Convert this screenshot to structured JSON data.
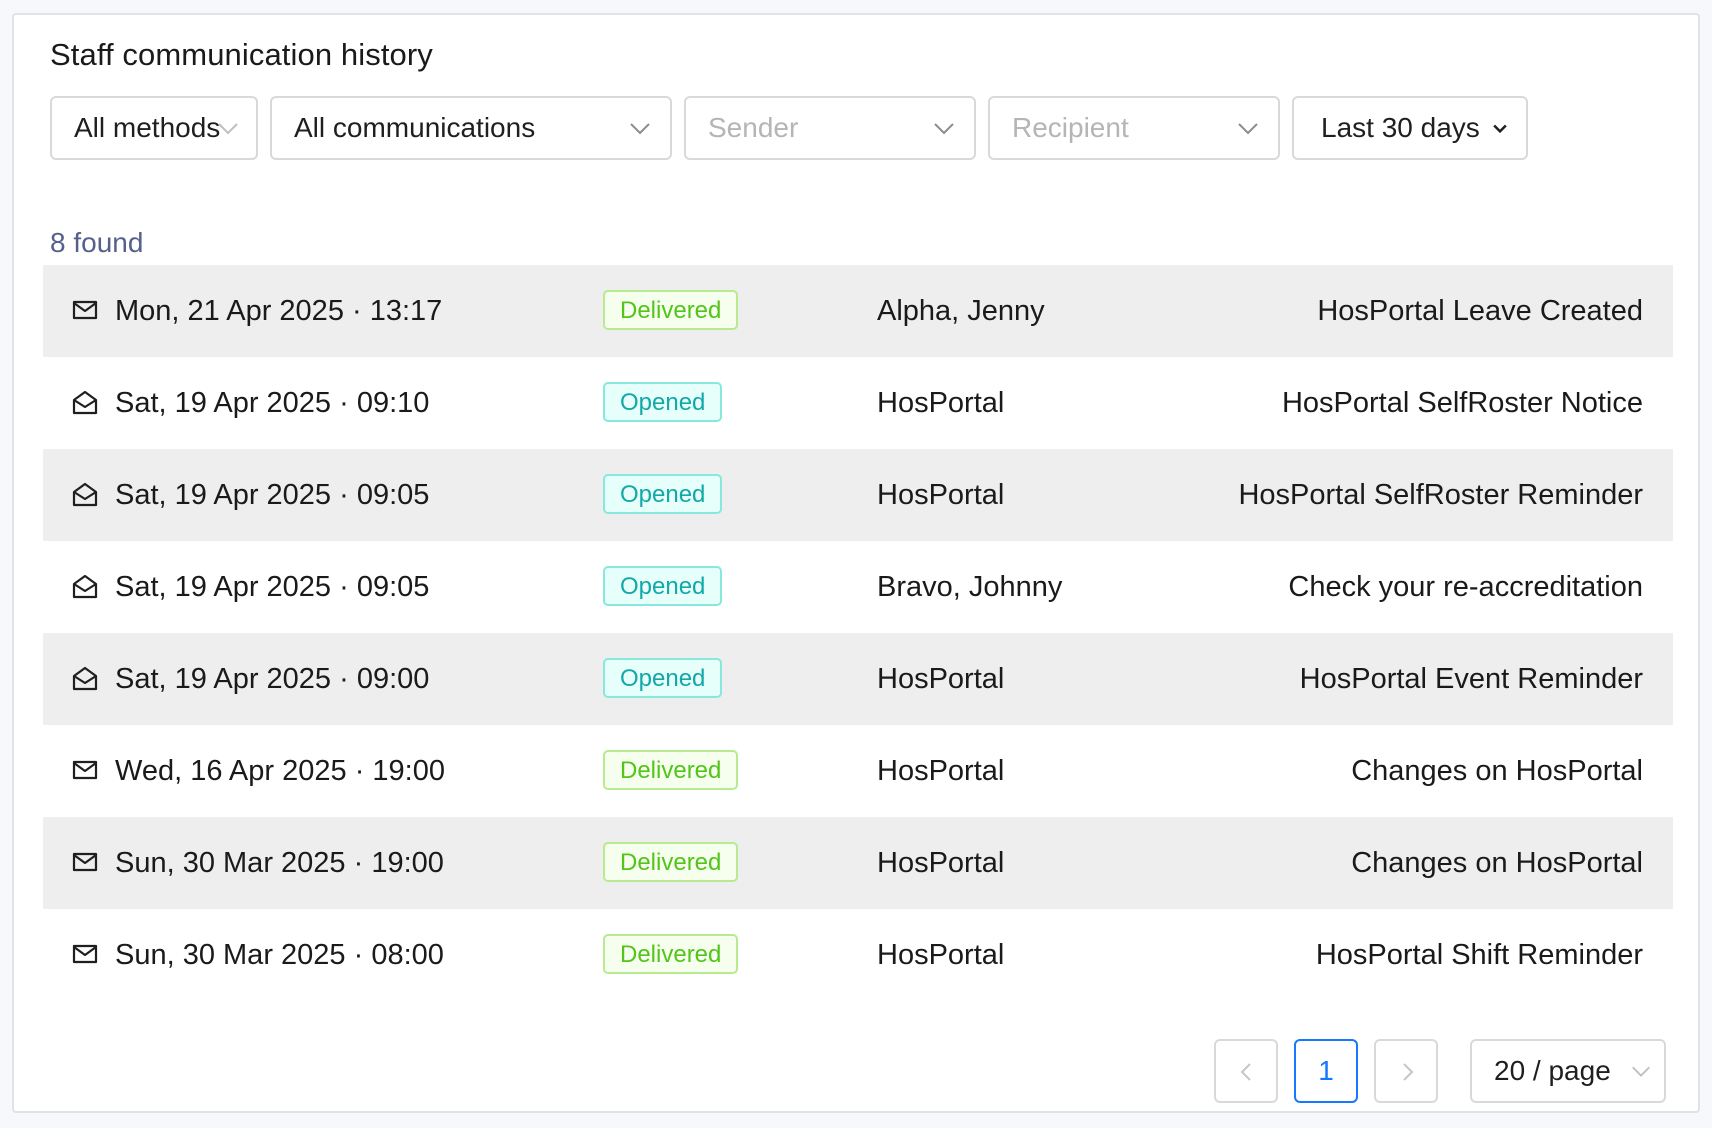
{
  "title": "Staff communication history",
  "filters": {
    "method": "All methods",
    "communication": "All communications",
    "sender_placeholder": "Sender",
    "recipient_placeholder": "Recipient",
    "date_range": "Last 30 days"
  },
  "count_label": "8 found",
  "rows": [
    {
      "icon": "envelope-closed-icon",
      "date": "Mon, 21 Apr 2025 · 13:17",
      "status": "Delivered",
      "sender": "Alpha, Jenny",
      "subject": "HosPortal Leave Created"
    },
    {
      "icon": "envelope-open-icon",
      "date": "Sat, 19 Apr 2025 · 09:10",
      "status": "Opened",
      "sender": "HosPortal",
      "subject": "HosPortal SelfRoster Notice"
    },
    {
      "icon": "envelope-open-icon",
      "date": "Sat, 19 Apr 2025 · 09:05",
      "status": "Opened",
      "sender": "HosPortal",
      "subject": "HosPortal SelfRoster Reminder"
    },
    {
      "icon": "envelope-open-icon",
      "date": "Sat, 19 Apr 2025 · 09:05",
      "status": "Opened",
      "sender": "Bravo, Johnny",
      "subject": "Check your re-accreditation"
    },
    {
      "icon": "envelope-open-icon",
      "date": "Sat, 19 Apr 2025 · 09:00",
      "status": "Opened",
      "sender": "HosPortal",
      "subject": "HosPortal Event Reminder"
    },
    {
      "icon": "envelope-closed-icon",
      "date": "Wed, 16 Apr 2025 · 19:00",
      "status": "Delivered",
      "sender": "HosPortal",
      "subject": "Changes on HosPortal"
    },
    {
      "icon": "envelope-closed-icon",
      "date": "Sun, 30 Mar 2025 · 19:00",
      "status": "Delivered",
      "sender": "HosPortal",
      "subject": "Changes on HosPortal"
    },
    {
      "icon": "envelope-closed-icon",
      "date": "Sun, 30 Mar 2025 · 08:00",
      "status": "Delivered",
      "sender": "HosPortal",
      "subject": "HosPortal Shift Reminder"
    }
  ],
  "pagination": {
    "current_page": "1",
    "page_size": "20 / page"
  },
  "colors": {
    "delivered": "#52c41a",
    "opened": "#13a8a8",
    "accent": "#1677ff",
    "row_stripe": "#eeeeee"
  }
}
